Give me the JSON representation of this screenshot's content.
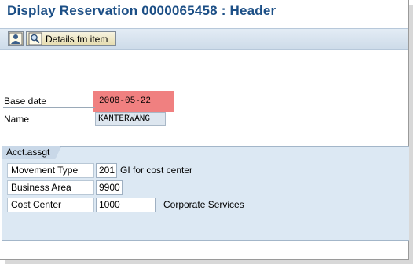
{
  "window": {
    "title": "Display Reservation 0000065458 : Header"
  },
  "toolbar": {
    "person_icon": "person-icon",
    "details_icon": "magnifier-icon",
    "details_label": "Details fm item"
  },
  "header_fields": {
    "base_date_label": "Base date",
    "base_date_value": "2008-05-22",
    "name_label": "Name",
    "name_value": "KANTERWANG"
  },
  "acct_assgt": {
    "tab_label": "Acct.assgt",
    "movement_type_label": "Movement Type",
    "movement_type_value": "201",
    "movement_type_text": "GI for cost center",
    "business_area_label": "Business Area",
    "business_area_value": "9900",
    "cost_center_label": "Cost Center",
    "cost_center_value": "1000",
    "cost_center_text": "Corporate Services"
  },
  "colors": {
    "title": "#1c4f86",
    "highlight": "#f08080",
    "group_bg": "#dce8f3",
    "toolbar_bg": "#d6e2ee"
  }
}
